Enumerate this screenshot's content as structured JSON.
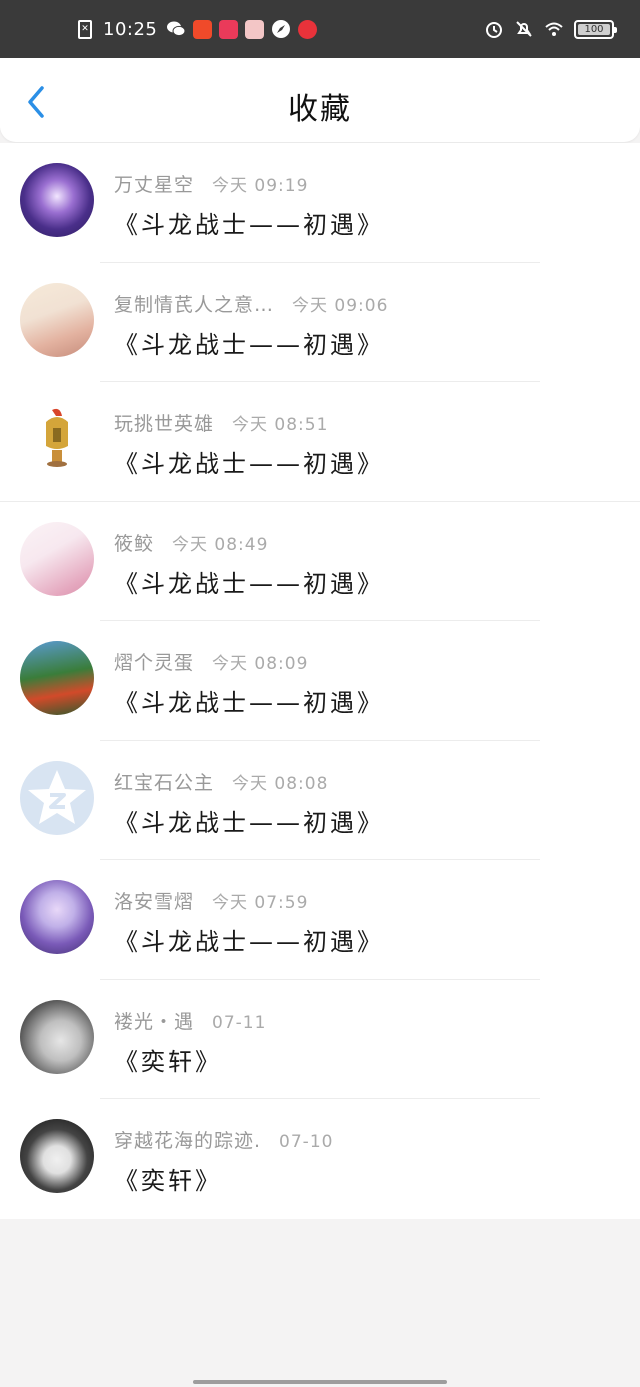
{
  "status_bar": {
    "time": "10:25",
    "battery": "100",
    "app_icons": [
      {
        "name": "wechat-icon",
        "color": "#ffffff"
      },
      {
        "name": "app-icon-orange",
        "color": "#f04a2a"
      },
      {
        "name": "app-icon-pink",
        "color": "#ea3a5a"
      },
      {
        "name": "app-icon-girl",
        "color": "#f3c6c6"
      },
      {
        "name": "compass-icon",
        "color": "#ffffff"
      },
      {
        "name": "app-icon-heart",
        "color": "#e8323a"
      }
    ]
  },
  "header": {
    "title": "收藏",
    "accent": "#2b8fe6"
  },
  "items": [
    {
      "user": "万丈星空",
      "time": "今天 09:19",
      "title": "《斗龙战士——初遇》",
      "avatar": "avatar-galaxy",
      "colors": [
        "#2a1b5c",
        "#9a6fd1"
      ]
    },
    {
      "user": "复制情芪人之意…",
      "time": "今天 09:06",
      "title": "《斗龙战士——初遇》",
      "avatar": "avatar-anime-boy",
      "colors": [
        "#f1e1d3",
        "#c58b7a"
      ]
    },
    {
      "user": "玩挑世英雄",
      "time": "今天 08:51",
      "title": "《斗龙战士——初遇》",
      "avatar": "avatar-helmet",
      "colors": [
        "#ffffff",
        "#d4a53a"
      ]
    },
    {
      "user": "筱鲛",
      "time": "今天 08:49",
      "title": "《斗龙战士——初遇》",
      "avatar": "avatar-pink-hair",
      "colors": [
        "#f7e8ef",
        "#e5a8bf"
      ]
    },
    {
      "user": "熠个灵蛋",
      "time": "今天 08:09",
      "title": "《斗龙战士——初遇》",
      "avatar": "avatar-cartoon",
      "colors": [
        "#3a7d3a",
        "#d24a2a"
      ]
    },
    {
      "user": "红宝石公主",
      "time": "今天 08:08",
      "title": "《斗龙战士——初遇》",
      "avatar": "avatar-default-qq",
      "colors": [
        "#d8e4f2",
        "#ffffff"
      ]
    },
    {
      "user": "洛安雪熠",
      "time": "今天 07:59",
      "title": "《斗龙战士——初遇》",
      "avatar": "avatar-anime-purple",
      "colors": [
        "#5a4a9a",
        "#c0b0e8"
      ]
    },
    {
      "user": "褛光・遇",
      "time": "07-11",
      "title": "《奕轩》",
      "avatar": "avatar-photo-bw",
      "colors": [
        "#bfbfbf",
        "#3a3a3a"
      ]
    },
    {
      "user": "穿越花海的踪迹.",
      "time": "07-10",
      "title": "《奕轩》",
      "avatar": "avatar-anime-dark",
      "colors": [
        "#1a1a1a",
        "#e0e0e0"
      ]
    }
  ]
}
